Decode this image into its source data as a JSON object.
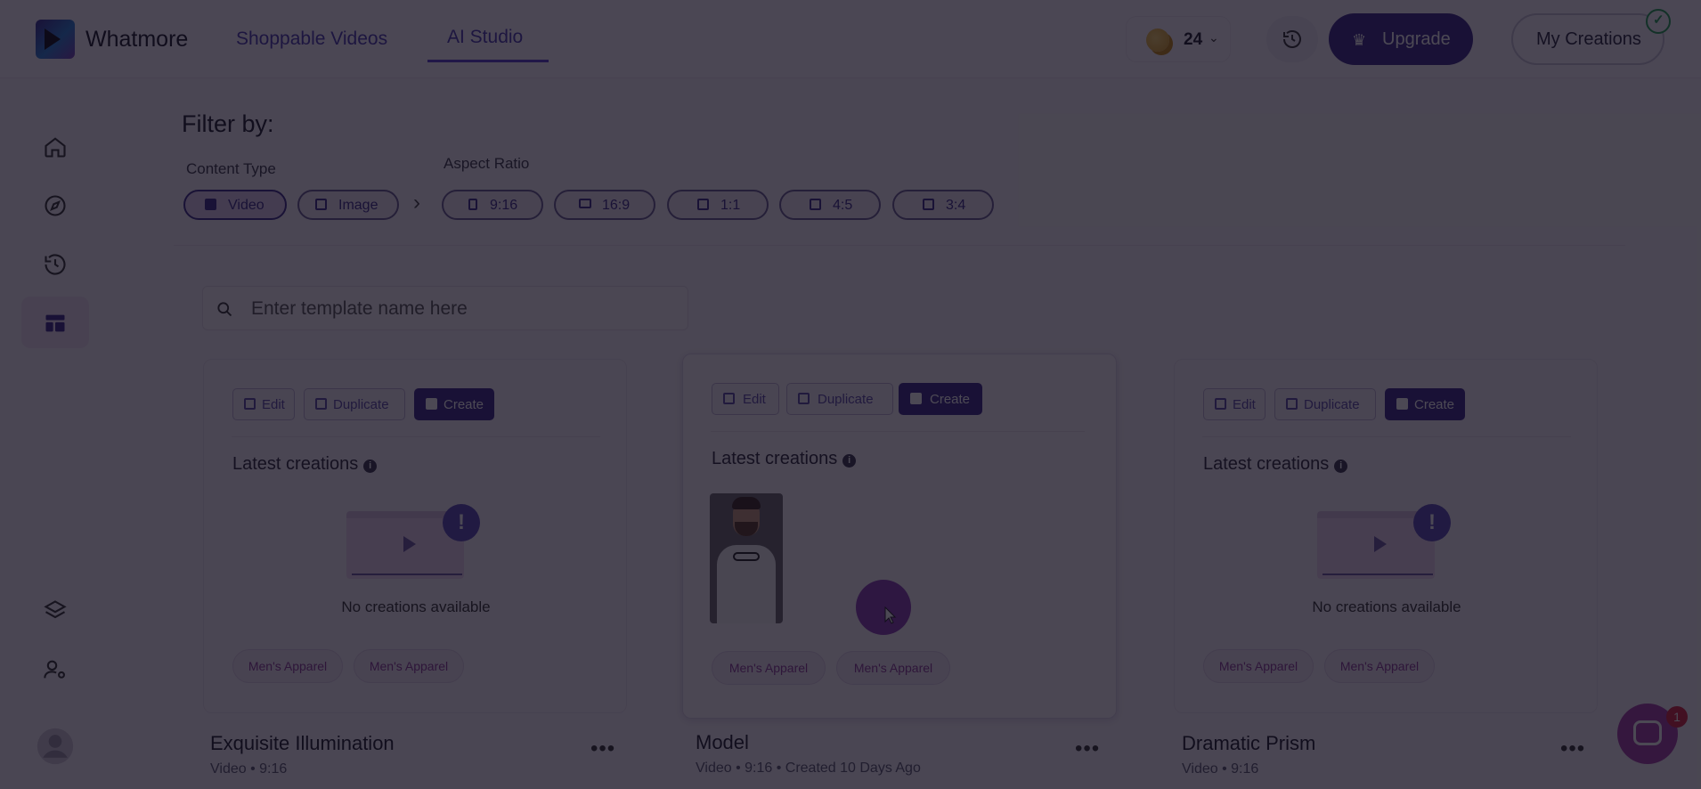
{
  "header": {
    "brand": "Whatmore",
    "tabs": [
      {
        "label": "Shoppable Videos"
      },
      {
        "label": "AI Studio"
      }
    ],
    "credits": "24",
    "upgrade_label": "Upgrade",
    "my_creations_label": "My Creations"
  },
  "sidebar": {
    "items": [
      "home-icon",
      "compass-icon",
      "history-icon",
      "templates-icon",
      "layers-icon",
      "user-settings-icon",
      "profile-icon"
    ]
  },
  "filter": {
    "title": "Filter by:",
    "content_type_label": "Content Type",
    "aspect_ratio_label": "Aspect Ratio",
    "content_types": [
      "Video",
      "Image"
    ],
    "aspect_ratios": [
      "9:16",
      "16:9",
      "1:1",
      "4:5",
      "3:4"
    ]
  },
  "search": {
    "placeholder": "Enter template name here"
  },
  "card_actions": {
    "edit": "Edit",
    "duplicate": "Duplicate",
    "create": "Create"
  },
  "latest_creations_label": "Latest creations",
  "no_creations_label": "No creations available",
  "cards": [
    {
      "name": "Exquisite Illumination",
      "meta": "Video • 9:16",
      "tags": [
        "Men's Apparel",
        "Men's Apparel"
      ]
    },
    {
      "name": "Model",
      "meta": "Video • 9:16 • Created 10 Days Ago",
      "tags": [
        "Men's Apparel",
        "Men's Apparel"
      ]
    },
    {
      "name": "Dramatic Prism",
      "meta": "Video • 9:16",
      "tags": [
        "Men's Apparel",
        "Men's Apparel"
      ]
    }
  ],
  "chat_badge": "1",
  "colors": {
    "accent": "#3d2a8a",
    "tag_text": "#8a3a98",
    "overlay": "rgba(14,10,24,0.74)"
  }
}
